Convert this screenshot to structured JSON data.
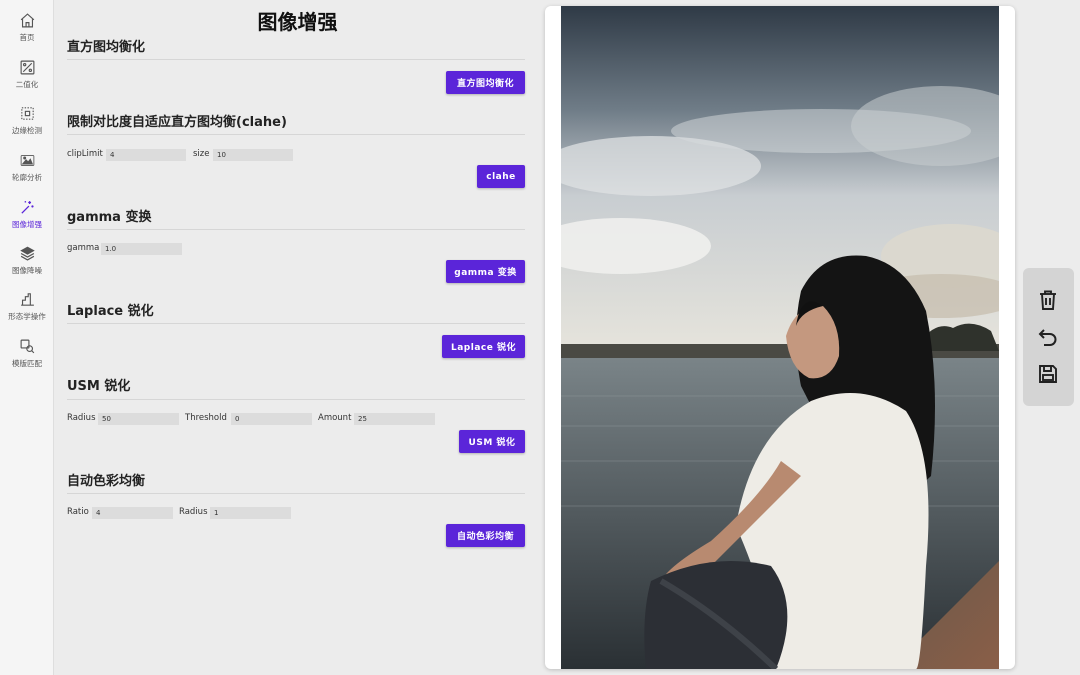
{
  "sidebar": {
    "items": [
      {
        "label": "首页",
        "icon": "home-icon"
      },
      {
        "label": "二值化",
        "icon": "binarize-icon"
      },
      {
        "label": "边缘检测",
        "icon": "edge-detect-icon"
      },
      {
        "label": "轮廓分析",
        "icon": "contour-icon"
      },
      {
        "label": "图像增强",
        "icon": "magic-wand-icon",
        "active": true
      },
      {
        "label": "图像降噪",
        "icon": "layers-icon"
      },
      {
        "label": "形态学操作",
        "icon": "morphology-icon"
      },
      {
        "label": "模版匹配",
        "icon": "template-match-icon"
      }
    ]
  },
  "page": {
    "title": "图像增强"
  },
  "sections": {
    "hist_eq": {
      "title": "直方图均衡化",
      "button": "直方图均衡化"
    },
    "clahe": {
      "title": "限制对比度自适应直方图均衡(clahe)",
      "cliplimit_label": "clipLimit",
      "cliplimit_value": "4",
      "size_label": "size",
      "size_value": "10",
      "button": "clahe"
    },
    "gamma": {
      "title": "gamma 变换",
      "gamma_label": "gamma",
      "gamma_value": "1.0",
      "button": "gamma 变换"
    },
    "laplace": {
      "title": "Laplace 锐化",
      "button": "Laplace 锐化"
    },
    "usm": {
      "title": "USM 锐化",
      "radius_label": "Radius",
      "radius_value": "50",
      "threshold_label": "Threshold",
      "threshold_value": "0",
      "amount_label": "Amount",
      "amount_value": "25",
      "button": "USM 锐化"
    },
    "ace": {
      "title": "自动色彩均衡",
      "ratio_label": "Ratio",
      "ratio_value": "4",
      "radius_label": "Radius",
      "radius_value": "1",
      "button": "自动色彩均衡"
    }
  },
  "toolbar": {
    "icons": [
      "trash-icon",
      "undo-icon",
      "save-icon"
    ]
  },
  "colors": {
    "accent": "#5b25d9",
    "background": "#ececec",
    "sidebar": "#f5f5f5",
    "toolbar": "#d4d4d4"
  }
}
